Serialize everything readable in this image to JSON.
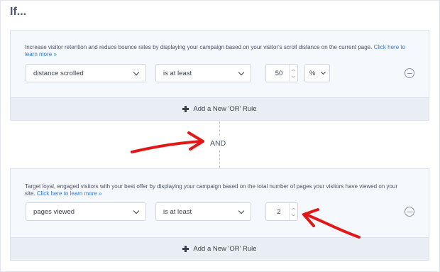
{
  "heading": "If...",
  "rules": [
    {
      "description": "Increase visitor retention and reduce bounce rates by displaying your campaign based on your visitor's scroll distance on the current page.",
      "link": "Click here to learn more »",
      "condition": "distance scrolled",
      "operator": "is at least",
      "value": "50",
      "unit": "%"
    },
    {
      "description": "Target loyal, engaged visitors with your best offer by displaying your campaign based on the total number of pages your visitors have viewed on your site.",
      "link": "Click here to learn more »",
      "condition": "pages viewed",
      "operator": "is at least",
      "value": "2"
    }
  ],
  "add_or_rule": "Add a New 'OR' Rule",
  "connector": "AND",
  "colors": {
    "annotation_arrow": "#e01818",
    "link": "#2b7bd7"
  }
}
